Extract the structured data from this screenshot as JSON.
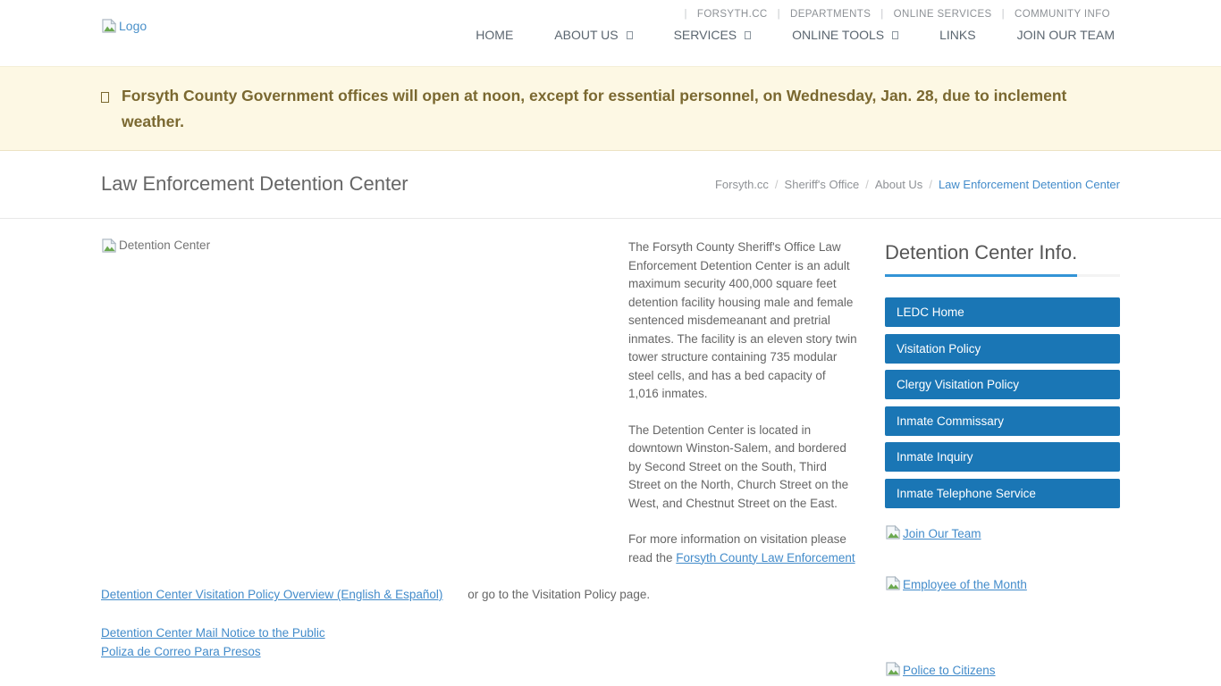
{
  "header": {
    "logo_alt": "Logo",
    "nav_separator": "|",
    "utility_nav": [
      "FORSYTH.CC",
      "DEPARTMENTS",
      "ONLINE SERVICES",
      "COMMUNITY INFO"
    ],
    "main_nav": [
      "HOME",
      "ABOUT US",
      "SERVICES",
      "ONLINE TOOLS",
      "LINKS",
      "JOIN OUR TEAM"
    ]
  },
  "alert": {
    "text": "Forsyth County Government offices will open at noon, except for essential personnel, on Wednesday, Jan. 28, due to inclement weather."
  },
  "page": {
    "title": "Law Enforcement Detention Center",
    "breadcrumb_separator": "/",
    "breadcrumb": [
      "Forsyth.cc",
      "Sheriff's Office",
      "About Us"
    ],
    "breadcrumb_current": "Law Enforcement Detention Center"
  },
  "content": {
    "image_alt": "Detention Center",
    "paragraph1": "The Forsyth County Sheriff's Office Law Enforcement Detention Center is an adult maximum security 400,000 square feet detention facility housing male and female sentenced misdemeanant and pretrial inmates. The facility is an eleven story twin tower structure containing 735 modular steel cells, and has a bed capacity of 1,016 inmates.",
    "paragraph2": "The Detention Center is located in downtown Winston-Salem, and bordered by Second Street on the South, Third Street on the North, Church Street on the West, and Chestnut Street on the East.",
    "paragraph3_prefix": "For more information on visitation please read the ",
    "visitation_link_line1": "Forsyth County Law Enforcement",
    "visitation_link_line2": "Detention Center Visitation Policy Overview (English & Español)",
    "paragraph3_suffix": "or go to the Visitation Policy page.",
    "mail_link1": "Detention Center Mail Notice to the Public",
    "mail_link2": "Poliza de Correo Para Presos"
  },
  "sidebar": {
    "heading": "Detention Center Info.",
    "buttons": [
      "LEDC Home",
      "Visitation Policy",
      "Clergy Visitation Policy",
      "Inmate Commissary",
      "Inmate Inquiry",
      "Inmate Telephone Service"
    ],
    "image_links": [
      "Join Our Team",
      "Employee of the Month",
      "Police to Citizens"
    ]
  },
  "colors": {
    "button_blue": "#1a76b5",
    "link_blue": "#428bca",
    "accent_blue": "#3394d6",
    "alert_bg": "#fdf8e4",
    "alert_text": "#7a6830"
  }
}
